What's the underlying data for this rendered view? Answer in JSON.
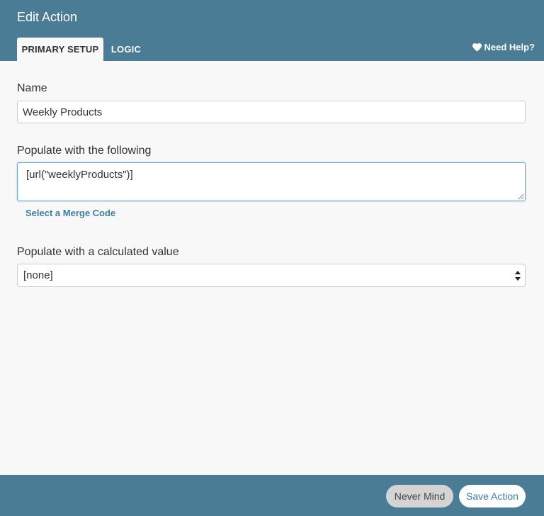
{
  "modal": {
    "title": "Edit Action"
  },
  "tabs": [
    {
      "label": "PRIMARY SETUP",
      "active": true
    },
    {
      "label": "LOGIC",
      "active": false
    }
  ],
  "help": {
    "label": "Need Help?",
    "icon": "heart-icon"
  },
  "form": {
    "name_label": "Name",
    "name_value": "Weekly Products",
    "populate_label": "Populate with the following",
    "populate_value": "[url(\"weeklyProducts\")]",
    "merge_link": "Select a Merge Code",
    "calc_label": "Populate with a calculated value",
    "calc_value": "[none]"
  },
  "footer": {
    "cancel_label": "Never Mind",
    "save_label": "Save Action"
  },
  "colors": {
    "header_bg": "#4a7c96",
    "body_bg": "#f8f8f8",
    "link": "#3e7da3",
    "cancel_bg": "#d4d4d4"
  }
}
